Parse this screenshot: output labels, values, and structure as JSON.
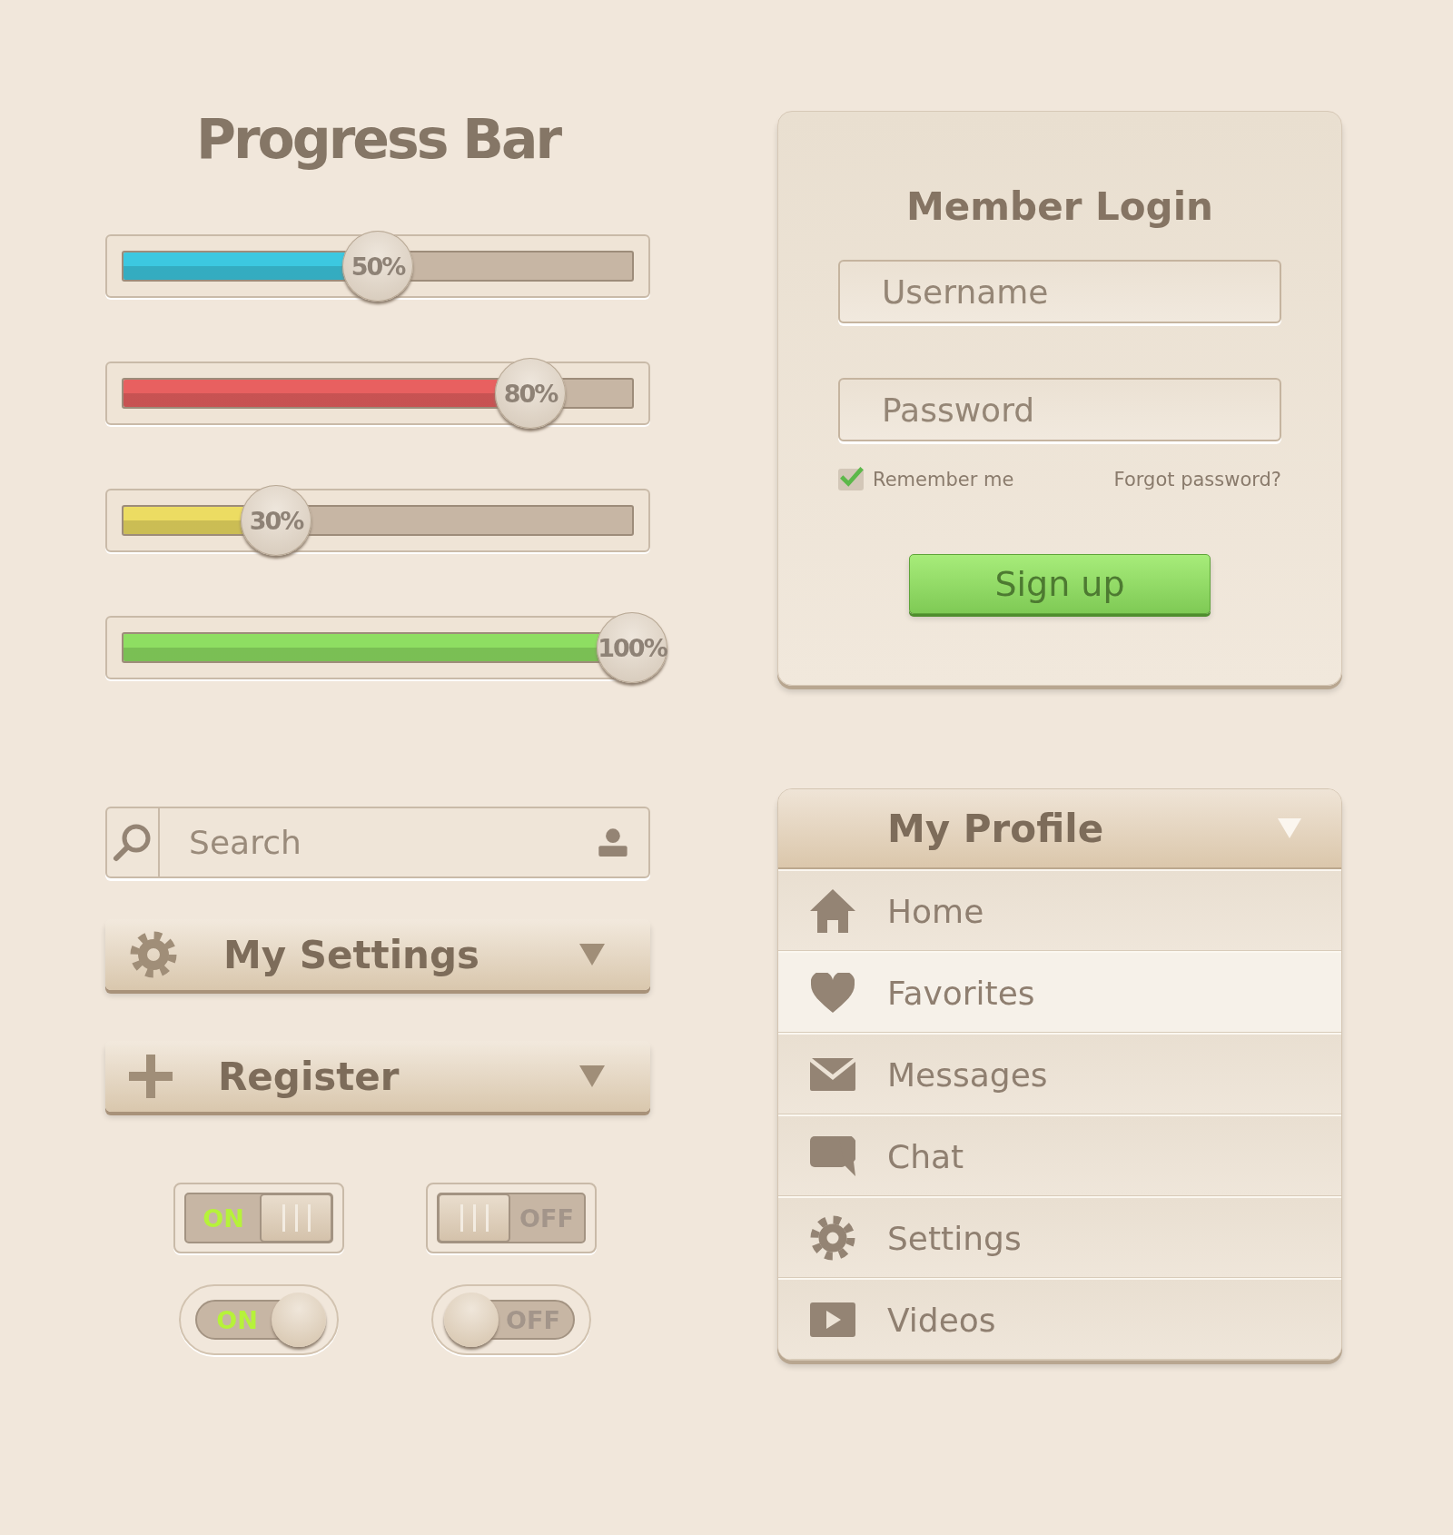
{
  "progress": {
    "title": "Progress Bar",
    "bars": [
      {
        "label": "50%",
        "level": 0.5,
        "color": "#3cc8e0"
      },
      {
        "label": "80%",
        "level": 0.8,
        "color": "#e86060"
      },
      {
        "label": "30%",
        "level": 0.3,
        "color": "#ecdc62"
      },
      {
        "label": "100%",
        "level": 1,
        "color": "#8ede62"
      }
    ]
  },
  "login": {
    "title": "Member Login",
    "username": {
      "placeholder": "Username"
    },
    "password": {
      "placeholder": "Password"
    },
    "remember": {
      "label": "Remember me",
      "checked": true
    },
    "forgot": "Forgot password?",
    "submit": "Sign up"
  },
  "search": {
    "placeholder": "Search"
  },
  "dropdowns": [
    {
      "label": "My Settings"
    },
    {
      "label": "Register"
    }
  ],
  "toggles": [
    {
      "kind": "square",
      "label": "ON",
      "on": true
    },
    {
      "kind": "square",
      "label": "OFF",
      "on": false
    },
    {
      "kind": "round",
      "label": "ON",
      "on": true
    },
    {
      "kind": "round",
      "label": "OFF",
      "on": false
    }
  ],
  "profile_menu": {
    "title": "My Profile",
    "items": [
      {
        "label": "Home",
        "selected": false
      },
      {
        "label": "Favorites",
        "selected": true
      },
      {
        "label": "Messages",
        "selected": false
      },
      {
        "label": "Chat",
        "selected": false
      },
      {
        "label": "Settings",
        "selected": false
      },
      {
        "label": "Videos",
        "selected": false
      }
    ]
  }
}
